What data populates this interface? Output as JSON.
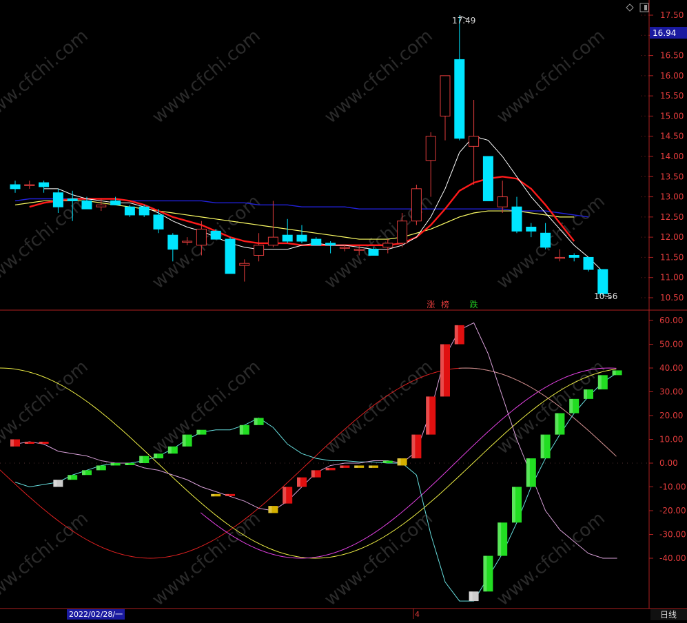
{
  "app": {
    "window_icons": [
      "diamond-icon",
      "panel-toggle-icon"
    ],
    "watermark": "www.cfchi.com",
    "date_label": "2022/02/28/一",
    "bottom_tick": "4",
    "period_label": "日线",
    "bottom_partial": "",
    "price_tag_bg": "#1a1aa0"
  },
  "markers": [
    {
      "text": "涨",
      "color": "#e23c3c",
      "index": 29
    },
    {
      "text": "榜",
      "color": "#e23c3c",
      "index": 30
    },
    {
      "text": "跌",
      "color": "#22cc22",
      "index": 32
    }
  ],
  "chart_data": [
    {
      "type": "candlestick",
      "title": "",
      "ylim": [
        10.3,
        17.8
      ],
      "y_ticks": [
        "17.50",
        "17.00",
        "16.50",
        "16.00",
        "15.50",
        "15.00",
        "14.50",
        "14.00",
        "13.50",
        "13.00",
        "12.50",
        "12.00",
        "11.50",
        "11.00",
        "10.50"
      ],
      "current_price": "16.94",
      "high_label": "17.49",
      "low_label": "10.56",
      "colors": {
        "up": "#e23c3c",
        "down": "#00e5ff",
        "ma_white": "#ffffff",
        "ma_red": "#ff1a1a",
        "ma_yellow": "#ffff66",
        "ma_blue": "#2222dd"
      },
      "candles": [
        {
          "o": 13.3,
          "h": 13.4,
          "l": 13.1,
          "c": 13.2
        },
        {
          "o": 13.3,
          "h": 13.4,
          "l": 13.2,
          "c": 13.3
        },
        {
          "o": 13.35,
          "h": 13.4,
          "l": 13.1,
          "c": 13.25
        },
        {
          "o": 13.1,
          "h": 13.2,
          "l": 12.6,
          "c": 12.75
        },
        {
          "o": 12.95,
          "h": 13.15,
          "l": 12.4,
          "c": 12.9
        },
        {
          "o": 12.9,
          "h": 13.0,
          "l": 12.7,
          "c": 12.7
        },
        {
          "o": 12.75,
          "h": 12.95,
          "l": 12.65,
          "c": 12.8
        },
        {
          "o": 12.9,
          "h": 13.0,
          "l": 12.8,
          "c": 12.8
        },
        {
          "o": 12.75,
          "h": 12.8,
          "l": 12.5,
          "c": 12.55
        },
        {
          "o": 12.75,
          "h": 12.8,
          "l": 12.5,
          "c": 12.55
        },
        {
          "o": 12.55,
          "h": 12.7,
          "l": 12.1,
          "c": 12.2
        },
        {
          "o": 12.05,
          "h": 12.1,
          "l": 11.4,
          "c": 11.7
        },
        {
          "o": 11.9,
          "h": 12.0,
          "l": 11.8,
          "c": 11.9
        },
        {
          "o": 11.8,
          "h": 12.4,
          "l": 11.55,
          "c": 12.2
        },
        {
          "o": 12.15,
          "h": 12.2,
          "l": 11.95,
          "c": 11.95
        },
        {
          "o": 11.95,
          "h": 12.0,
          "l": 11.1,
          "c": 11.1
        },
        {
          "o": 11.3,
          "h": 11.45,
          "l": 10.9,
          "c": 11.35
        },
        {
          "o": 11.55,
          "h": 12.1,
          "l": 11.4,
          "c": 11.8
        },
        {
          "o": 11.8,
          "h": 12.9,
          "l": 11.75,
          "c": 12.0
        },
        {
          "o": 12.05,
          "h": 12.45,
          "l": 11.85,
          "c": 11.9
        },
        {
          "o": 12.05,
          "h": 12.3,
          "l": 11.85,
          "c": 11.9
        },
        {
          "o": 11.95,
          "h": 12.0,
          "l": 11.8,
          "c": 11.8
        },
        {
          "o": 11.85,
          "h": 11.9,
          "l": 11.6,
          "c": 11.8
        },
        {
          "o": 11.75,
          "h": 11.8,
          "l": 11.65,
          "c": 11.75
        },
        {
          "o": 11.7,
          "h": 11.8,
          "l": 11.55,
          "c": 11.7
        },
        {
          "o": 11.7,
          "h": 11.75,
          "l": 11.55,
          "c": 11.55
        },
        {
          "o": 11.75,
          "h": 11.95,
          "l": 11.6,
          "c": 11.85
        },
        {
          "o": 11.85,
          "h": 12.6,
          "l": 11.75,
          "c": 12.4
        },
        {
          "o": 12.4,
          "h": 13.3,
          "l": 12.3,
          "c": 13.2
        },
        {
          "o": 13.9,
          "h": 14.6,
          "l": 13.0,
          "c": 14.5
        },
        {
          "o": 15.0,
          "h": 16.0,
          "l": 14.4,
          "c": 16.0
        },
        {
          "o": 16.4,
          "h": 17.49,
          "l": 14.4,
          "c": 14.45
        },
        {
          "o": 14.25,
          "h": 15.4,
          "l": 13.3,
          "c": 14.5
        },
        {
          "o": 14.0,
          "h": 14.0,
          "l": 12.9,
          "c": 12.9
        },
        {
          "o": 12.75,
          "h": 13.4,
          "l": 12.6,
          "c": 13.0
        },
        {
          "o": 12.75,
          "h": 13.0,
          "l": 12.1,
          "c": 12.15
        },
        {
          "o": 12.25,
          "h": 12.35,
          "l": 12.0,
          "c": 12.15
        },
        {
          "o": 12.1,
          "h": 12.35,
          "l": 11.7,
          "c": 11.75
        },
        {
          "o": 11.5,
          "h": 11.7,
          "l": 11.4,
          "c": 11.5
        },
        {
          "o": 11.55,
          "h": 11.6,
          "l": 11.4,
          "c": 11.5
        },
        {
          "o": 11.5,
          "h": 11.5,
          "l": 11.15,
          "c": 11.2
        },
        {
          "o": 11.2,
          "h": 11.2,
          "l": 10.56,
          "c": 10.6
        }
      ],
      "ma_white": [
        null,
        null,
        13.2,
        13.2,
        13.05,
        12.95,
        12.9,
        12.85,
        12.85,
        12.75,
        12.6,
        12.4,
        12.25,
        12.15,
        12.0,
        11.85,
        11.75,
        11.7,
        11.7,
        11.7,
        11.8,
        11.85,
        11.8,
        11.8,
        11.75,
        11.7,
        11.7,
        11.8,
        12.0,
        12.5,
        13.2,
        14.1,
        14.5,
        14.4,
        14.0,
        13.5,
        13.0,
        12.6,
        12.2,
        11.8,
        11.5,
        11.15
      ],
      "ma_red": [
        null,
        12.75,
        12.85,
        12.9,
        12.95,
        12.95,
        12.95,
        12.95,
        12.9,
        12.8,
        12.65,
        12.5,
        12.4,
        12.3,
        12.15,
        12.0,
        11.9,
        11.85,
        11.85,
        11.85,
        11.8,
        11.8,
        11.8,
        11.8,
        11.8,
        11.8,
        11.8,
        11.85,
        12.0,
        12.3,
        12.7,
        13.15,
        13.35,
        13.45,
        13.5,
        13.45,
        13.2,
        12.8,
        12.35,
        11.9
      ],
      "ma_yellow": [
        12.8,
        12.85,
        12.9,
        12.9,
        12.9,
        12.9,
        12.85,
        12.8,
        12.75,
        12.7,
        12.65,
        12.6,
        12.55,
        12.5,
        12.45,
        12.4,
        12.35,
        12.3,
        12.25,
        12.2,
        12.15,
        12.1,
        12.05,
        12.0,
        11.95,
        11.95,
        11.95,
        12.0,
        12.1,
        12.2,
        12.35,
        12.5,
        12.6,
        12.65,
        12.65,
        12.65,
        12.6,
        12.55,
        12.5,
        12.5
      ],
      "ma_blue": [
        12.9,
        12.95,
        12.95,
        12.95,
        12.95,
        12.95,
        12.95,
        12.95,
        12.9,
        12.9,
        12.9,
        12.9,
        12.9,
        12.9,
        12.85,
        12.85,
        12.85,
        12.8,
        12.8,
        12.8,
        12.75,
        12.75,
        12.75,
        12.75,
        12.7,
        12.7,
        12.7,
        12.7,
        12.7,
        12.7,
        12.7,
        12.7,
        12.7,
        12.7,
        12.7,
        12.65,
        12.65,
        12.65,
        12.6,
        12.55,
        12.5
      ]
    },
    {
      "type": "oscillator",
      "title": "",
      "ylim": [
        -64,
        64
      ],
      "y_ticks": [
        "60.00",
        "50.00",
        "40.00",
        "30.00",
        "20.00",
        "10.00",
        "0.00",
        "-10.00",
        "-20.00",
        "-30.00",
        "-40.00"
      ],
      "bars": [
        {
          "v0": 7,
          "v1": 10,
          "color": "red"
        },
        {
          "v0": 9,
          "v1": 9,
          "color": "red"
        },
        {
          "v0": 9,
          "v1": 9,
          "color": "red"
        },
        {
          "v0": -10,
          "v1": -7,
          "color": "white"
        },
        {
          "v0": -7,
          "v1": -5,
          "color": "green"
        },
        {
          "v0": -5,
          "v1": -3,
          "color": "green"
        },
        {
          "v0": -3,
          "v1": -1,
          "color": "green"
        },
        {
          "v0": -1,
          "v1": 0,
          "color": "green"
        },
        {
          "v0": 0,
          "v1": 0,
          "color": "green"
        },
        {
          "v0": 0,
          "v1": 3,
          "color": "green"
        },
        {
          "v0": 2,
          "v1": 4,
          "color": "green"
        },
        {
          "v0": 4,
          "v1": 7,
          "color": "green"
        },
        {
          "v0": 7,
          "v1": 12,
          "color": "green"
        },
        {
          "v0": 12,
          "v1": 14,
          "color": "green"
        },
        {
          "v0": -14,
          "v1": -13,
          "color": "yellow"
        },
        {
          "v0": -13,
          "v1": -13,
          "color": "red"
        },
        {
          "v0": 12,
          "v1": 16,
          "color": "green"
        },
        {
          "v0": 16,
          "v1": 19,
          "color": "green"
        },
        {
          "v0": -21,
          "v1": -18,
          "color": "yellow"
        },
        {
          "v0": -17,
          "v1": -10,
          "color": "red"
        },
        {
          "v0": -10,
          "v1": -6,
          "color": "red"
        },
        {
          "v0": -6,
          "v1": -3,
          "color": "red"
        },
        {
          "v0": -3,
          "v1": -2,
          "color": "red"
        },
        {
          "v0": -2,
          "v1": -1,
          "color": "red"
        },
        {
          "v0": -2,
          "v1": -1,
          "color": "yellow"
        },
        {
          "v0": -2,
          "v1": -1,
          "color": "yellow"
        },
        {
          "v0": 0,
          "v1": 1,
          "color": "green"
        },
        {
          "v0": -1,
          "v1": 2,
          "color": "yellow"
        },
        {
          "v0": 2,
          "v1": 12,
          "color": "red"
        },
        {
          "v0": 12,
          "v1": 28,
          "color": "red"
        },
        {
          "v0": 28,
          "v1": 50,
          "color": "red"
        },
        {
          "v0": 50,
          "v1": 58,
          "color": "red"
        },
        {
          "v0": -58,
          "v1": -54,
          "color": "white"
        },
        {
          "v0": -54,
          "v1": -39,
          "color": "green"
        },
        {
          "v0": -39,
          "v1": -25,
          "color": "green"
        },
        {
          "v0": -25,
          "v1": -10,
          "color": "green"
        },
        {
          "v0": -10,
          "v1": 2,
          "color": "green"
        },
        {
          "v0": 2,
          "v1": 12,
          "color": "green"
        },
        {
          "v0": 12,
          "v1": 21,
          "color": "green"
        },
        {
          "v0": 21,
          "v1": 27,
          "color": "green"
        },
        {
          "v0": 27,
          "v1": 31,
          "color": "green"
        },
        {
          "v0": 31,
          "v1": 37,
          "color": "green"
        },
        {
          "v0": 37,
          "v1": 39,
          "color": "green"
        }
      ],
      "line_cyan": [
        -8,
        -10,
        -9,
        -8,
        -5,
        -3,
        -1,
        0,
        0,
        1,
        3,
        6,
        10,
        13,
        14,
        14,
        16,
        19,
        15,
        8,
        4,
        2,
        1,
        1,
        0.5,
        0.5,
        0,
        0,
        -5,
        -30,
        -50,
        -58,
        -58,
        -48,
        -38,
        -25,
        -10,
        2,
        12,
        21,
        28,
        34,
        38
      ],
      "line_pink": [
        8,
        9,
        8,
        5,
        4,
        3,
        1,
        0,
        0,
        -2,
        -3,
        -5,
        -7,
        -10,
        -12,
        -14,
        -16,
        -19,
        -20,
        -16,
        -10,
        -4,
        -1,
        0,
        0,
        1,
        1,
        0,
        5,
        22,
        45,
        56,
        59,
        46,
        28,
        10,
        -5,
        -20,
        -28,
        -33,
        -38,
        -40,
        -40
      ],
      "line_yellow_cycle": {
        "min": -40,
        "max": 40,
        "phase": 0.5
      },
      "line_red_cycle": {
        "min": -40,
        "max": 40
      },
      "line_magenta_cycle": {
        "min": -40,
        "max": 40
      }
    }
  ]
}
